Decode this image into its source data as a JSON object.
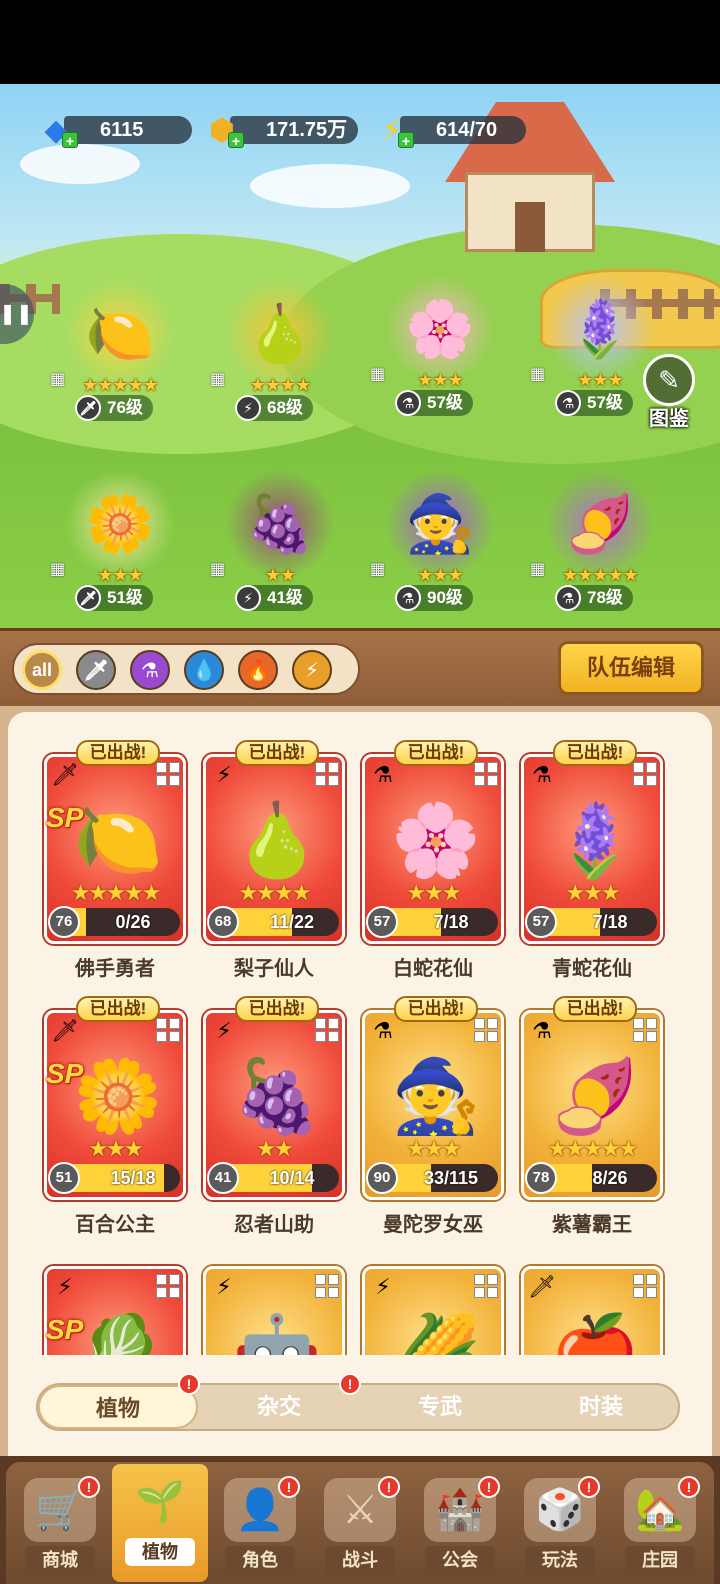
{
  "resources": {
    "diamonds": "6115",
    "gold": "171.75万",
    "energy": "614/70"
  },
  "codex_label": "图鉴",
  "team_units": [
    {
      "level": "76级",
      "stars": "★★★★★",
      "type_icon": "sword-icon",
      "emoji": "🍋"
    },
    {
      "level": "68级",
      "stars": "★★★★",
      "type_icon": "lightning-icon",
      "emoji": "🍐"
    },
    {
      "level": "57级",
      "stars": "★★★",
      "type_icon": "potion-icon",
      "emoji": "🌸"
    },
    {
      "level": "57级",
      "stars": "★★★",
      "type_icon": "potion-icon",
      "emoji": "🪻"
    },
    {
      "level": "51级",
      "stars": "★★★",
      "type_icon": "sword-icon",
      "emoji": "🌼"
    },
    {
      "level": "41级",
      "stars": "★★",
      "type_icon": "lightning-icon",
      "emoji": "🍇"
    },
    {
      "level": "90级",
      "stars": "★★★",
      "type_icon": "potion-icon",
      "emoji": "🧙"
    },
    {
      "level": "78级",
      "stars": "★★★★★",
      "type_icon": "potion-icon",
      "emoji": "🍠"
    }
  ],
  "filters": [
    {
      "name": "all",
      "label": "all",
      "color": "#b88a4a"
    },
    {
      "name": "sword",
      "label": "🗡",
      "color": "#8a8a8a"
    },
    {
      "name": "potion",
      "label": "⚗",
      "color": "#9a4ad0"
    },
    {
      "name": "water",
      "label": "💧",
      "color": "#2a8ad8"
    },
    {
      "name": "fire",
      "label": "🔥",
      "color": "#e8682a"
    },
    {
      "name": "lightning",
      "label": "⚡",
      "color": "#e8a02a"
    }
  ],
  "team_edit_label": "队伍编辑",
  "deployed_label": "已出战!",
  "sp_label": "SP",
  "cards": [
    {
      "name": "佛手勇者",
      "level": "76",
      "progress": "0/26",
      "fill": 0.0,
      "stars": "★★★★★",
      "bg": "red",
      "type": "🗡",
      "sp": true,
      "deployed": true,
      "emoji": "🍋"
    },
    {
      "name": "梨子仙人",
      "level": "68",
      "progress": "11/22",
      "fill": 0.5,
      "stars": "★★★★",
      "bg": "red",
      "type": "⚡",
      "sp": false,
      "deployed": true,
      "emoji": "🍐"
    },
    {
      "name": "白蛇花仙",
      "level": "57",
      "progress": "7/18",
      "fill": 0.39,
      "stars": "★★★",
      "bg": "red",
      "type": "⚗",
      "sp": false,
      "deployed": true,
      "emoji": "🌸"
    },
    {
      "name": "青蛇花仙",
      "level": "57",
      "progress": "7/18",
      "fill": 0.39,
      "stars": "★★★",
      "bg": "red",
      "type": "⚗",
      "sp": false,
      "deployed": true,
      "emoji": "🪻"
    },
    {
      "name": "百合公主",
      "level": "51",
      "progress": "15/18",
      "fill": 0.83,
      "stars": "★★★",
      "bg": "red",
      "type": "🗡",
      "sp": true,
      "deployed": true,
      "emoji": "🌼"
    },
    {
      "name": "忍者山助",
      "level": "41",
      "progress": "10/14",
      "fill": 0.71,
      "stars": "★★",
      "bg": "red",
      "type": "⚡",
      "sp": false,
      "deployed": true,
      "emoji": "🍇"
    },
    {
      "name": "曼陀罗女巫",
      "level": "90",
      "progress": "33/115",
      "fill": 0.29,
      "stars": "★★★",
      "bg": "gold",
      "type": "⚗",
      "sp": false,
      "deployed": true,
      "emoji": "🧙"
    },
    {
      "name": "紫薯霸王",
      "level": "78",
      "progress": "8/26",
      "fill": 0.31,
      "stars": "★★★★★",
      "bg": "gold",
      "type": "⚗",
      "sp": false,
      "deployed": true,
      "emoji": "🍠"
    },
    {
      "name": "",
      "level": "",
      "progress": "",
      "fill": 0,
      "stars": "",
      "bg": "red",
      "type": "⚡",
      "sp": true,
      "deployed": false,
      "emoji": "🥬"
    },
    {
      "name": "",
      "level": "",
      "progress": "",
      "fill": 0,
      "stars": "",
      "bg": "gold",
      "type": "⚡",
      "sp": false,
      "deployed": false,
      "emoji": "🤖"
    },
    {
      "name": "",
      "level": "",
      "progress": "",
      "fill": 0,
      "stars": "",
      "bg": "gold",
      "type": "⚡",
      "sp": false,
      "deployed": false,
      "emoji": "🌽"
    },
    {
      "name": "",
      "level": "",
      "progress": "",
      "fill": 0,
      "stars": "",
      "bg": "gold",
      "type": "🗡",
      "sp": false,
      "deployed": false,
      "emoji": "🍎"
    }
  ],
  "subtabs": [
    {
      "label": "植物",
      "active": true,
      "badge": true
    },
    {
      "label": "杂交",
      "active": false,
      "badge": true
    },
    {
      "label": "专武",
      "active": false,
      "badge": false
    },
    {
      "label": "时装",
      "active": false,
      "badge": false
    }
  ],
  "bottom_nav": [
    {
      "label": "商城",
      "icon": "shop-icon",
      "glyph": "🛒",
      "active": false
    },
    {
      "label": "植物",
      "icon": "plant-icon",
      "glyph": "🌱",
      "active": true
    },
    {
      "label": "角色",
      "icon": "character-icon",
      "glyph": "👤",
      "active": false
    },
    {
      "label": "战斗",
      "icon": "battle-icon",
      "glyph": "⚔",
      "active": false
    },
    {
      "label": "公会",
      "icon": "guild-icon",
      "glyph": "🏰",
      "active": false
    },
    {
      "label": "玩法",
      "icon": "gameplay-icon",
      "glyph": "🎲",
      "active": false
    },
    {
      "label": "庄园",
      "icon": "manor-icon",
      "glyph": "🏡",
      "active": false
    }
  ],
  "badge_mark": "!"
}
